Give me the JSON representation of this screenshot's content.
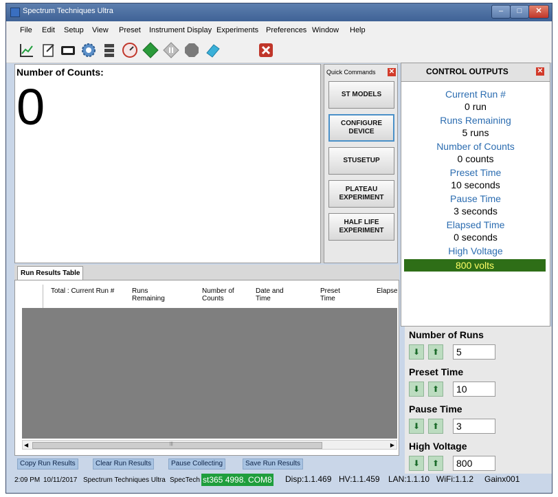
{
  "window": {
    "title": "Spectrum Techniques Ultra"
  },
  "menu": [
    "File",
    "Edit",
    "Setup",
    "View",
    "Preset",
    "Instrument Display",
    "Experiments",
    "Preferences",
    "Window",
    "Help"
  ],
  "toolbar": {
    "icons": [
      "chart-icon",
      "notebook-icon",
      "counter-icon",
      "gear-icon",
      "stack-icon",
      "gauge-icon",
      "start-icon",
      "pause-icon",
      "stop-icon",
      "eraser-icon",
      "exit-icon"
    ],
    "colors": {
      "start": "#2a9a3a",
      "stop": "#7a7a7a",
      "eraser": "#3ab0d8",
      "exit": "#c0362a"
    }
  },
  "counts_panel": {
    "label": "Number of Counts:",
    "value": "0"
  },
  "quick_commands": {
    "title": "Quick Commands",
    "buttons": [
      {
        "label": "ST MODELS"
      },
      {
        "label": "CONFIGURE DEVICE"
      },
      {
        "label": "STUSETUP"
      },
      {
        "label": "PLATEAU EXPERIMENT"
      },
      {
        "label": "HALF LIFE EXPERIMENT"
      }
    ]
  },
  "control_outputs": {
    "title": "CONTROL OUTPUTS",
    "items": [
      {
        "label": "Current Run #",
        "value": "0 run"
      },
      {
        "label": "Runs Remaining",
        "value": "5 runs"
      },
      {
        "label": "Number  of Counts",
        "value": "0 counts"
      },
      {
        "label": "Preset Time",
        "value": "10 seconds"
      },
      {
        "label": "Pause Time",
        "value": "3 seconds"
      },
      {
        "label": "Elapsed Time",
        "value": "0 seconds"
      },
      {
        "label": "High Voltage",
        "value": "800 volts"
      }
    ]
  },
  "run_results": {
    "tab": "Run Results Table",
    "columns": [
      "Total : Current Run #",
      "Runs Remaining",
      "Number of Counts",
      "Date and Time",
      "Preset Time",
      "Elapsed Time"
    ],
    "rows": []
  },
  "settings": {
    "number_of_runs": {
      "label": "Number of Runs",
      "value": "5"
    },
    "preset_time": {
      "label": "Preset Time",
      "value": "10"
    },
    "pause_time": {
      "label": "Pause Time",
      "value": "3"
    },
    "high_voltage": {
      "label": "High Voltage",
      "value": "800"
    }
  },
  "actions": [
    "Copy Run Results",
    "Clear Run Results",
    "Pause Collecting",
    "Save Run Results"
  ],
  "status": {
    "time": "2:09 PM",
    "date": "10/11/2017",
    "app": "Spectrum Techniques Ultra",
    "vendor": "SpecTech",
    "device": "st365 4998. COM8",
    "disp": "Disp:1.1.469",
    "hv": "HV:1.1.459",
    "lan": "LAN:1.1.10",
    "wifi": "WiFi:1.1.2",
    "gain": "Gainx001"
  }
}
